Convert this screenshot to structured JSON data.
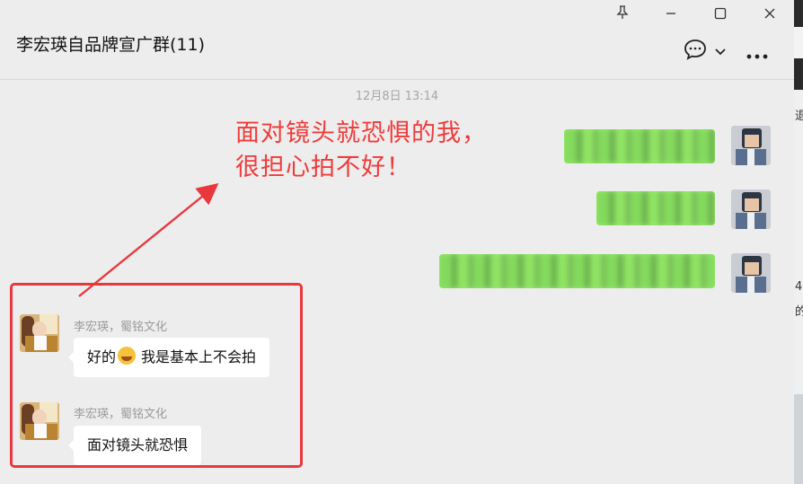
{
  "window": {
    "title": "李宏瑛自品牌宣广群(11)",
    "buttons": [
      "pin-icon",
      "minimize-icon",
      "maximize-icon",
      "close-icon"
    ]
  },
  "timestamp": "12月8日 13:14",
  "annotation": {
    "line1": "面对镜头就恐惧的我，",
    "line2": "很担心拍不好！",
    "color": "#f03b3b"
  },
  "messages": [
    {
      "sender": "李宏瑛，蜀铭文化",
      "text_before": "好的",
      "emoji": "rolling-laughing-emoji",
      "text_after": "我是基本上不会拍"
    },
    {
      "sender": "李宏瑛，蜀铭文化",
      "text": "面对镜头就恐惧"
    }
  ],
  "own_messages": [
    "blurred",
    "blurred",
    "blurred"
  ],
  "side_strip": {
    "chars": [
      "退",
      "4",
      "的"
    ]
  },
  "colors": {
    "bubble_self": "#95ec69",
    "highlight": "#e8383d",
    "background": "#ededed"
  }
}
